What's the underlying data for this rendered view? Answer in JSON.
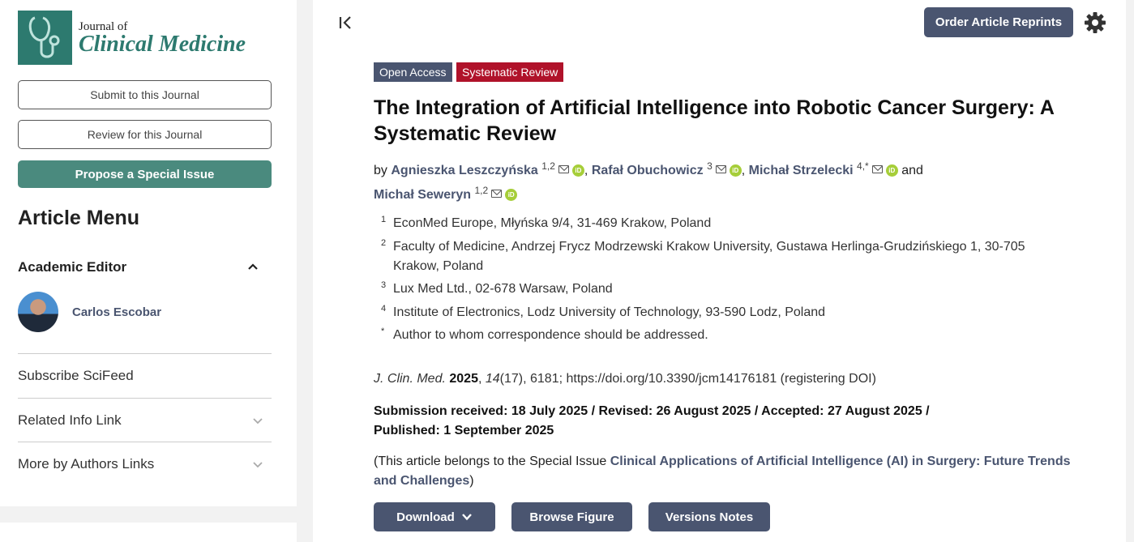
{
  "journal": {
    "logo_small": "Journal of",
    "logo_big": "Clinical Medicine"
  },
  "sidebar": {
    "submit_label": "Submit to this Journal",
    "review_label": "Review for this Journal",
    "propose_label": "Propose a Special Issue",
    "menu_title": "Article Menu",
    "academic_editor_label": "Academic Editor",
    "editor_name": "Carlos Escobar",
    "links": [
      {
        "label": "Subscribe SciFeed",
        "has_chevron": false
      },
      {
        "label": "Related Info Link",
        "has_chevron": true
      },
      {
        "label": "More by Authors Links",
        "has_chevron": true
      }
    ]
  },
  "header": {
    "order_reprints_label": "Order Article Reprints"
  },
  "article": {
    "badges": {
      "open_access": "Open Access",
      "type": "Systematic Review"
    },
    "title": "The Integration of Artificial Intelligence into Robotic Cancer Surgery: A Systematic Review",
    "by_label": "by",
    "and_label": "and",
    "authors": [
      {
        "name": "Agnieszka Leszczyńska",
        "aff": "1,2"
      },
      {
        "name": "Rafał Obuchowicz",
        "aff": "3"
      },
      {
        "name": "Michał Strzelecki",
        "aff": "4,*"
      },
      {
        "name": "Michał Seweryn",
        "aff": "1,2"
      }
    ],
    "affiliations": [
      {
        "num": "1",
        "text": "EconMed Europe, Młyńska 9/4, 31-469 Krakow, Poland"
      },
      {
        "num": "2",
        "text": "Faculty of Medicine, Andrzej Frycz Modrzewski Krakow University, Gustawa Herlinga-Grudzińskiego 1, 30-705 Krakow, Poland"
      },
      {
        "num": "3",
        "text": "Lux Med Ltd., 02-678 Warsaw, Poland"
      },
      {
        "num": "4",
        "text": "Institute of Electronics, Lodz University of Technology, 93-590 Lodz, Poland"
      },
      {
        "num": "*",
        "text": "Author to whom correspondence should be addressed."
      }
    ],
    "citation": {
      "journal_abbr": "J. Clin. Med.",
      "year": "2025",
      "volume": "14",
      "rest": "(17), 6181; https://doi.org/10.3390/jcm14176181 (registering DOI)"
    },
    "dates_line1": "Submission received: 18 July 2025 / Revised: 26 August 2025 / Accepted: 27 August 2025 /",
    "dates_line2": "Published: 1 September 2025",
    "special_issue_prefix": "(This article belongs to the Special Issue ",
    "special_issue_link": "Clinical Applications of Artificial Intelligence (AI) in Surgery: Future Trends and Challenges",
    "special_issue_suffix": ")"
  },
  "actions": {
    "download_label": "Download",
    "browse_figure_label": "Browse Figure",
    "versions_notes_label": "Versions Notes"
  },
  "colors": {
    "brand_green": "#2d7a6f",
    "button_slate": "#4a5570",
    "systematic_review_red": "#b0122a",
    "orcid_green": "#a6ce39"
  }
}
